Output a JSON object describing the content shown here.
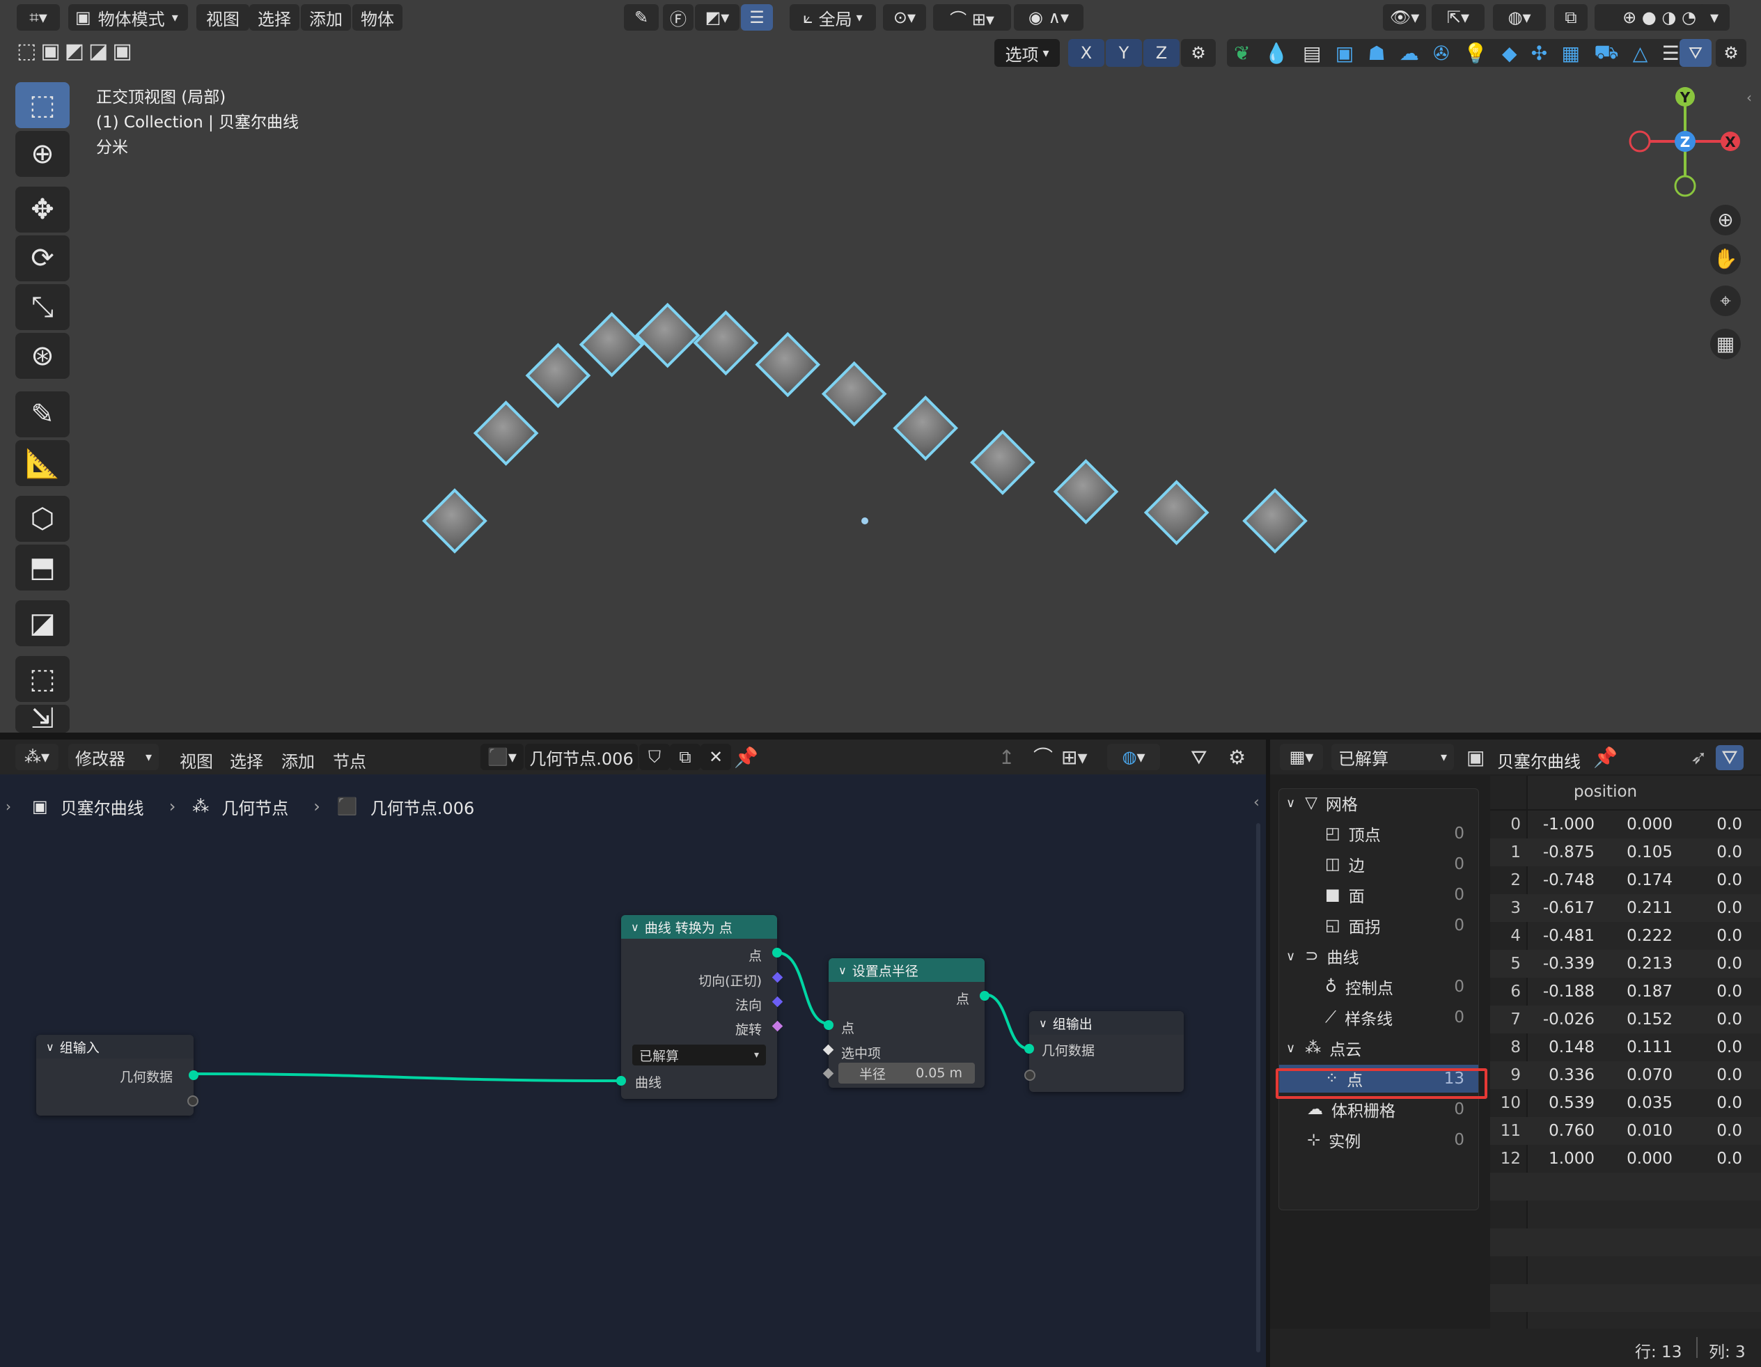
{
  "viewport_header": {
    "mode": "物体模式",
    "menus": [
      "视图",
      "选择",
      "添加",
      "物体"
    ],
    "transform_orientation": "全局",
    "options_label": "选项",
    "axes": [
      "X",
      "Y",
      "Z"
    ]
  },
  "viewport": {
    "view_name": "正交顶视图 (局部)",
    "collection_line": "(1) Collection | 贝塞尔曲线",
    "units": "分米",
    "gizmo": {
      "y": "Y",
      "z": "Z",
      "x": "X"
    }
  },
  "node_editor": {
    "editor_type": "修改器",
    "menus": [
      "视图",
      "选择",
      "添加",
      "节点"
    ],
    "node_group_name": "几何节点.006",
    "breadcrumb": [
      "贝塞尔曲线",
      "几何节点",
      "几何节点.006"
    ],
    "nodes": {
      "group_input": {
        "title": "组输入",
        "output": "几何数据"
      },
      "curve_to_points": {
        "title": "曲线 转换为 点",
        "outputs": [
          "点",
          "切向(正切)",
          "法向",
          "旋转"
        ],
        "mode": "已解算",
        "input": "曲线"
      },
      "set_radius": {
        "title": "设置点半径",
        "output": "点",
        "inputs": [
          "点",
          "选中项"
        ],
        "radius_label": "半径",
        "radius_value": "0.05 m"
      },
      "group_output": {
        "title": "组输出",
        "input": "几何数据"
      }
    }
  },
  "spreadsheet": {
    "mode": "已解算",
    "object_name": "贝塞尔曲线",
    "tree": [
      {
        "label": "网格",
        "level": 0,
        "count": ""
      },
      {
        "label": "顶点",
        "level": 1,
        "count": "0"
      },
      {
        "label": "边",
        "level": 1,
        "count": "0"
      },
      {
        "label": "面",
        "level": 1,
        "count": "0"
      },
      {
        "label": "面拐",
        "level": 1,
        "count": "0"
      },
      {
        "label": "曲线",
        "level": 0,
        "count": ""
      },
      {
        "label": "控制点",
        "level": 1,
        "count": "0"
      },
      {
        "label": "样条线",
        "level": 1,
        "count": "0"
      },
      {
        "label": "点云",
        "level": 0,
        "count": ""
      },
      {
        "label": "点",
        "level": 1,
        "count": "13"
      },
      {
        "label": "体积栅格",
        "level": 0,
        "count": "0"
      },
      {
        "label": "实例",
        "level": 0,
        "count": "0"
      }
    ],
    "column_header": "position",
    "rows": [
      [
        "0",
        "-1.000",
        "0.000",
        "0.0"
      ],
      [
        "1",
        "-0.875",
        "0.105",
        "0.0"
      ],
      [
        "2",
        "-0.748",
        "0.174",
        "0.0"
      ],
      [
        "3",
        "-0.617",
        "0.211",
        "0.0"
      ],
      [
        "4",
        "-0.481",
        "0.222",
        "0.0"
      ],
      [
        "5",
        "-0.339",
        "0.213",
        "0.0"
      ],
      [
        "6",
        "-0.188",
        "0.187",
        "0.0"
      ],
      [
        "7",
        "-0.026",
        "0.152",
        "0.0"
      ],
      [
        "8",
        "0.148",
        "0.111",
        "0.0"
      ],
      [
        "9",
        "0.336",
        "0.070",
        "0.0"
      ],
      [
        "10",
        "0.539",
        "0.035",
        "0.0"
      ],
      [
        "11",
        "0.760",
        "0.010",
        "0.0"
      ],
      [
        "12",
        "1.000",
        "0.000",
        "0.0"
      ]
    ],
    "status_rows": "行: 13",
    "status_cols": "列: 3"
  },
  "colors": {
    "selection_outline": "#e53935",
    "socket_geometry": "#00d6a3",
    "socket_vector": "#6c5ff5",
    "socket_rotation": "#c77be6",
    "node_head_geometry": "#1e6b64",
    "gizmo_x": "#e2404a",
    "gizmo_y": "#8ac53e",
    "gizmo_z": "#3a8fe6"
  }
}
